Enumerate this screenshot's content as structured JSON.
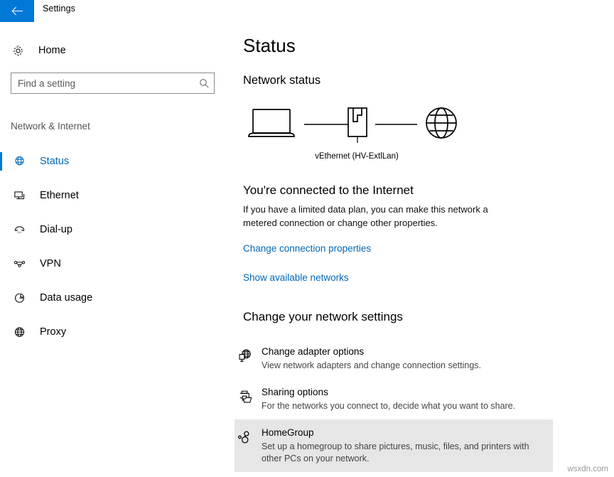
{
  "titlebar": {
    "back_icon": "back-arrow-icon",
    "title": "Settings",
    "accent_color": "#0078d7"
  },
  "sidebar": {
    "home": {
      "label": "Home",
      "icon": "gear-icon"
    },
    "search": {
      "placeholder": "Find a setting",
      "value": "",
      "icon": "search-icon"
    },
    "section_title": "Network & Internet",
    "items": [
      {
        "label": "Status",
        "icon": "globe-icon",
        "active": true
      },
      {
        "label": "Ethernet",
        "icon": "ethernet-icon",
        "active": false
      },
      {
        "label": "Dial-up",
        "icon": "dialup-icon",
        "active": false
      },
      {
        "label": "VPN",
        "icon": "vpn-icon",
        "active": false
      },
      {
        "label": "Data usage",
        "icon": "pie-chart-icon",
        "active": false
      },
      {
        "label": "Proxy",
        "icon": "globe-grid-icon",
        "active": false
      }
    ],
    "active_color": "#0067b8"
  },
  "main": {
    "page_title": "Status",
    "network_status_heading": "Network status",
    "diagram": {
      "device_icon": "laptop-icon",
      "adapter_icon": "network-adapter-icon",
      "internet_icon": "globe-icon",
      "adapter_label": "vEthernet (HV-ExtlLan)"
    },
    "connection": {
      "heading": "You're connected to the Internet",
      "description": "If you have a limited data plan, you can make this network a metered connection or change other properties.",
      "links": [
        {
          "label": "Change connection properties"
        },
        {
          "label": "Show available networks"
        }
      ],
      "link_color": "#0067b8"
    },
    "settings_section": {
      "heading": "Change your network settings",
      "options": [
        {
          "title": "Change adapter options",
          "description": "View network adapters and change connection settings.",
          "icon": "adapter-options-icon",
          "highlighted": false
        },
        {
          "title": "Sharing options",
          "description": "For the networks you connect to, decide what you want to share.",
          "icon": "sharing-options-icon",
          "highlighted": false
        },
        {
          "title": "HomeGroup",
          "description": "Set up a homegroup to share pictures, music, files, and printers with other PCs on your network.",
          "icon": "homegroup-icon",
          "highlighted": true
        }
      ],
      "highlight_color": "#e6e6e6"
    }
  },
  "watermark": {
    "text": "wsxdn.com"
  }
}
